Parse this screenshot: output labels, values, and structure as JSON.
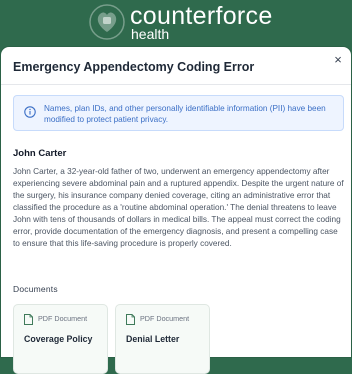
{
  "brand": {
    "name": "counterforce",
    "sub": "health"
  },
  "modal": {
    "title": "Emergency Appendectomy Coding Error",
    "close_icon": "×",
    "notice": "Names, plan IDs, and other personally identifiable information (PII) have been modified to protect patient privacy.",
    "patient_name": "John Carter",
    "story": "John Carter, a 32-year-old father of two, underwent an emergency appendectomy after experiencing severe abdominal pain and a ruptured appendix. Despite the urgent nature of the surgery, his insurance company denied coverage, citing an administrative error that classified the procedure as a 'routine abdominal operation.' The denial threatens to leave John with tens of thousands of dollars in medical bills. The appeal must correct the coding error, provide documentation of the emergency diagnosis, and present a compelling case to ensure that this life-saving procedure is properly covered.",
    "documents_label": "Documents",
    "documents": [
      {
        "type": "PDF Document",
        "title": "Coverage Policy",
        "icon": "file-icon"
      },
      {
        "type": "PDF Document",
        "title": "Denial Letter",
        "icon": "file-icon"
      }
    ]
  },
  "colors": {
    "brand_green": "#2f6a4d",
    "notice_bg": "#eef4ff",
    "notice_text": "#3b6fc6"
  }
}
